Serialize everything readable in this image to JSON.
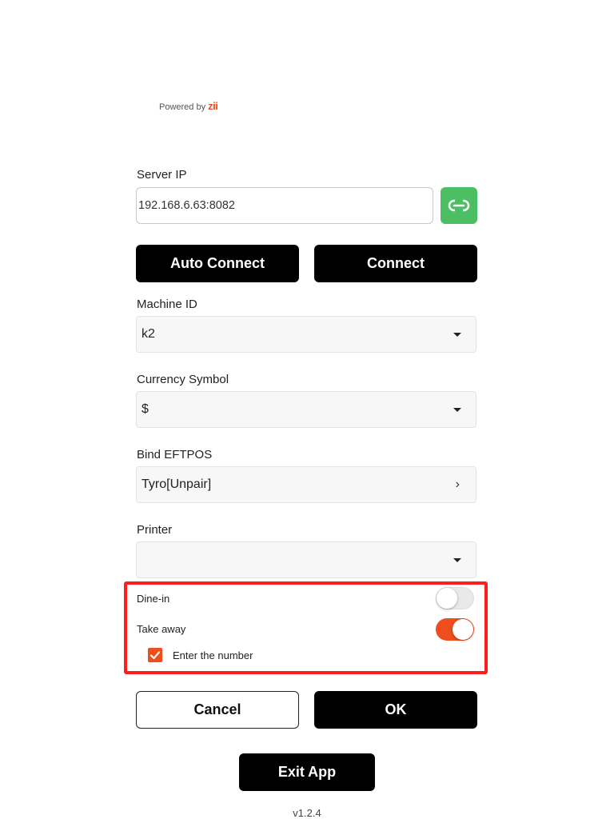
{
  "branding": {
    "prefix": "Powered by",
    "brand": "zii"
  },
  "server_ip": {
    "label": "Server IP",
    "value": "192.168.6.63:8082",
    "link_icon": "link-icon"
  },
  "buttons": {
    "auto_connect": "Auto Connect",
    "connect": "Connect",
    "cancel": "Cancel",
    "ok": "OK",
    "exit": "Exit App"
  },
  "machine_id": {
    "label": "Machine ID",
    "value": "k2"
  },
  "currency": {
    "label": "Currency Symbol",
    "value": "$"
  },
  "eftpos": {
    "label": "Bind EFTPOS",
    "value": "Tyro[Unpair]",
    "chevron": "›"
  },
  "printer": {
    "label": "Printer",
    "value": ""
  },
  "order_types": {
    "dine_in": {
      "label": "Dine-in",
      "enabled": false
    },
    "take_away": {
      "label": "Take away",
      "enabled": true
    },
    "enter_number": {
      "label": "Enter the number",
      "checked": true
    }
  },
  "version": "v1.2.4",
  "colors": {
    "accent": "#ee4d1e",
    "link_button": "#4cbe63",
    "highlight": "#ff1e1e"
  }
}
